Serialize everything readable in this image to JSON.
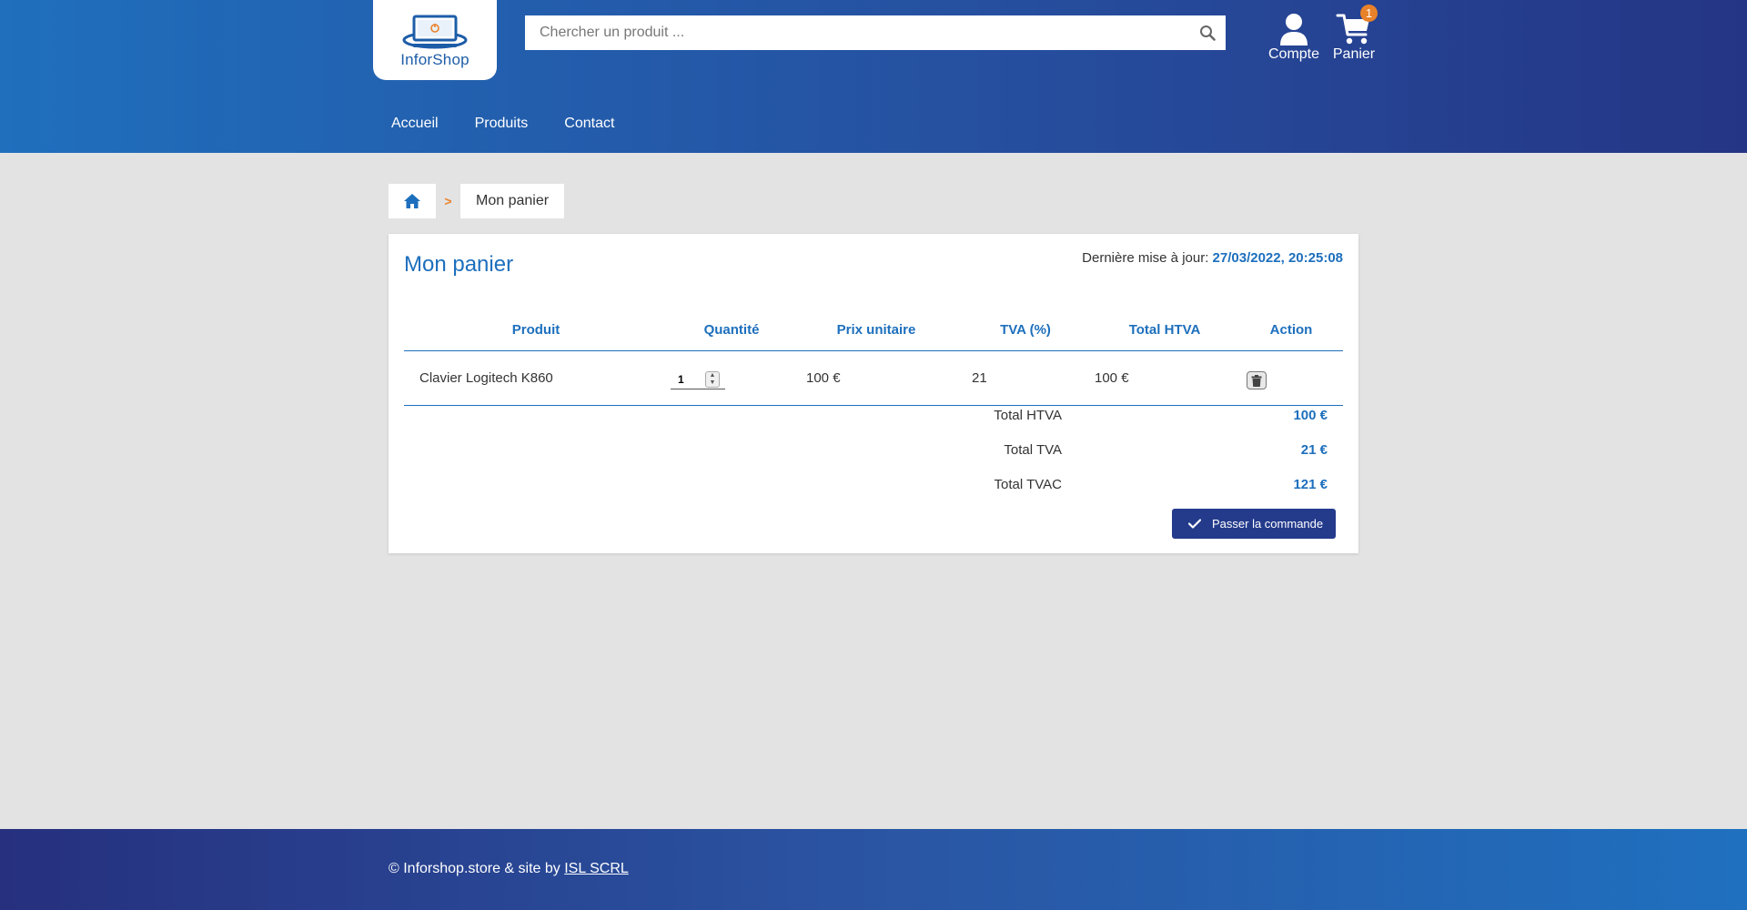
{
  "header": {
    "logo_text": "InforShop",
    "search": {
      "placeholder": "Chercher un produit ...",
      "value": ""
    },
    "account_label": "Compte",
    "cart_label": "Panier",
    "cart_count": "1",
    "icons": {
      "search": "search-icon",
      "account": "user-icon",
      "cart": "cart-icon"
    },
    "nav": [
      {
        "label": "Accueil"
      },
      {
        "label": "Produits"
      },
      {
        "label": "Contact"
      }
    ]
  },
  "breadcrumb": {
    "separator": ">",
    "current": "Mon panier",
    "home_icon": "home-icon"
  },
  "cart": {
    "title": "Mon panier",
    "updated_label": "Dernière mise à jour:",
    "updated_value": "27/03/2022, 20:25:08",
    "columns": [
      "Produit",
      "Quantité",
      "Prix unitaire",
      "TVA (%)",
      "Total HTVA",
      "Action"
    ],
    "rows": [
      {
        "product": "Clavier Logitech K860",
        "quantity": "1",
        "unit_price": "100 €",
        "vat": "21",
        "total_htva": "100 €",
        "action_icon": "trash-icon"
      }
    ],
    "totals": [
      {
        "label": "Total HTVA",
        "value": "100 €"
      },
      {
        "label": "Total TVA",
        "value": "21 €"
      },
      {
        "label": "Total TVAC",
        "value": "121 €"
      }
    ],
    "order_button": "Passer la commande"
  },
  "footer": {
    "text": "© Inforshop.store & site by ",
    "link": "ISL SCRL"
  },
  "colors": {
    "accent": "#1d6fbd",
    "button": "#243b8c",
    "badge": "#e8822a",
    "background": "#e3e3e3"
  }
}
